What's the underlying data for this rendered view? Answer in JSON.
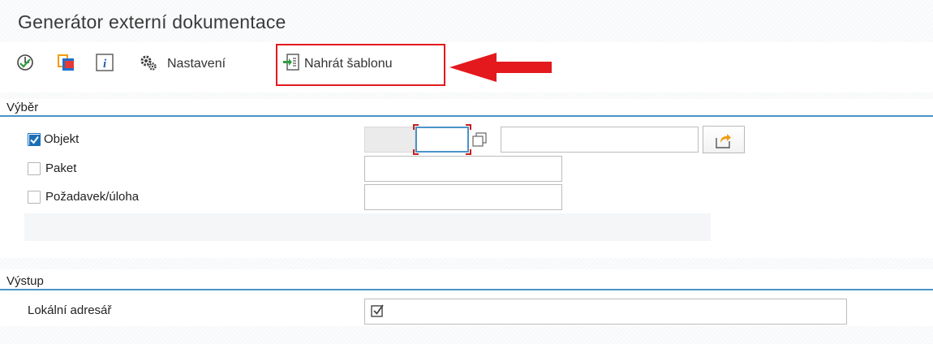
{
  "title": "Generátor externí dokumentace",
  "toolbar": {
    "settings_label": "Nastavení",
    "upload_template_label": "Nahrát šablonu"
  },
  "colors": {
    "accent": "#4a93c8",
    "highlight": "#e3191e",
    "checkbox": "#1b6fb8",
    "icon_orange": "#f39c12",
    "icon_blue": "#1f6fd0",
    "icon_red": "#e53935"
  },
  "selection": {
    "header": "Výběr",
    "rows": [
      {
        "label": "Objekt",
        "checked": true,
        "value": ""
      },
      {
        "label": "Paket",
        "checked": false,
        "value": ""
      },
      {
        "label": "Požadavek/úloha",
        "checked": false,
        "value": ""
      }
    ]
  },
  "output": {
    "header": "Výstup",
    "rows": [
      {
        "label": "Lokální adresář",
        "checked": true
      }
    ]
  }
}
